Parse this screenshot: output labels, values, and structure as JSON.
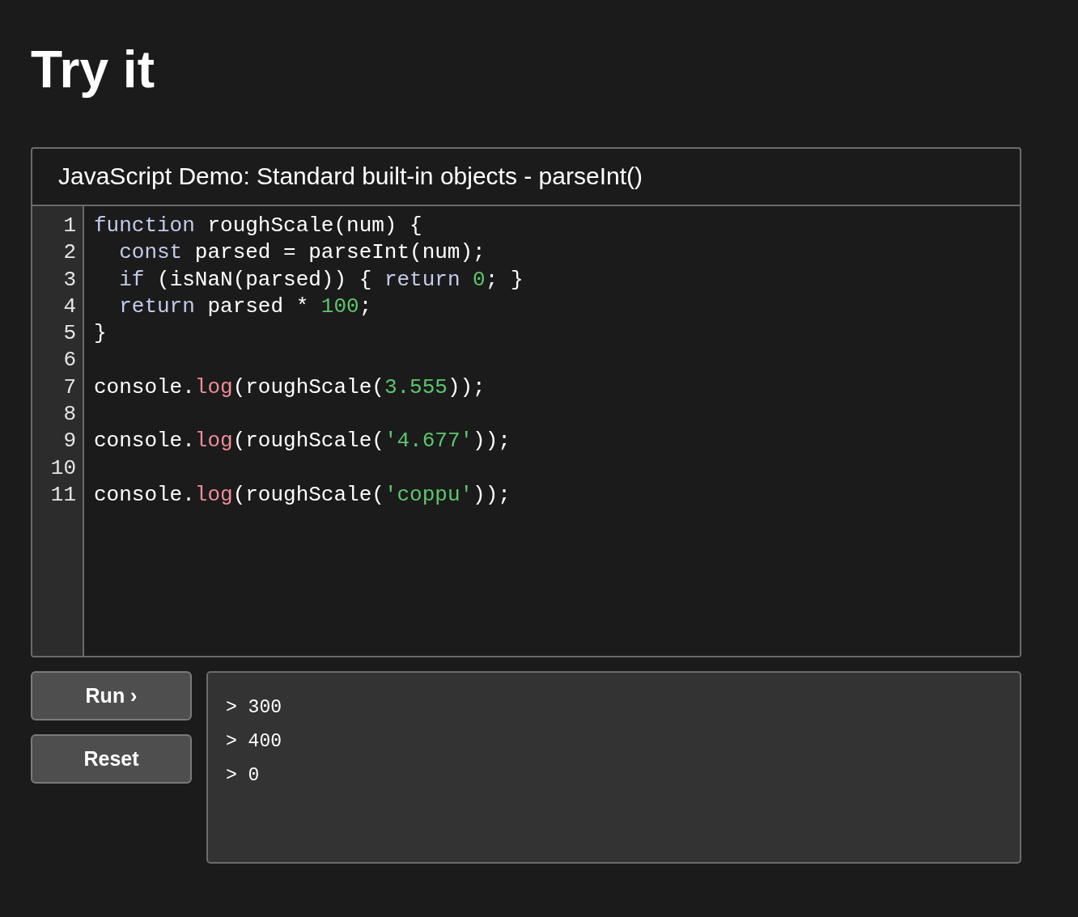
{
  "heading": "Try it",
  "demo": {
    "title": "JavaScript Demo: Standard built-in objects - parseInt()",
    "lines": [
      {
        "number": "1",
        "tokens": [
          {
            "kind": "keyword",
            "text": "function"
          },
          {
            "kind": "plain",
            "text": " roughScale(num) {"
          }
        ]
      },
      {
        "number": "2",
        "tokens": [
          {
            "kind": "keyword",
            "text": "  const"
          },
          {
            "kind": "plain",
            "text": " parsed = parseInt(num);"
          }
        ]
      },
      {
        "number": "3",
        "tokens": [
          {
            "kind": "keyword",
            "text": "  if"
          },
          {
            "kind": "plain",
            "text": " (isNaN(parsed)) { "
          },
          {
            "kind": "keyword",
            "text": "return "
          },
          {
            "kind": "number",
            "text": "0"
          },
          {
            "kind": "plain",
            "text": "; }"
          }
        ]
      },
      {
        "number": "4",
        "tokens": [
          {
            "kind": "keyword",
            "text": "  return"
          },
          {
            "kind": "plain",
            "text": " parsed * "
          },
          {
            "kind": "number",
            "text": "100"
          },
          {
            "kind": "plain",
            "text": ";"
          }
        ]
      },
      {
        "number": "5",
        "tokens": [
          {
            "kind": "plain",
            "text": "}"
          }
        ]
      },
      {
        "number": "6"
      },
      {
        "number": "7",
        "tokens": [
          {
            "kind": "plain",
            "text": "console."
          },
          {
            "kind": "method",
            "text": "log"
          },
          {
            "kind": "plain",
            "text": "(roughScale("
          },
          {
            "kind": "number",
            "text": "3.555"
          },
          {
            "kind": "plain",
            "text": "));"
          }
        ]
      },
      {
        "number": "8"
      },
      {
        "number": "9",
        "tokens": [
          {
            "kind": "plain",
            "text": "console."
          },
          {
            "kind": "method",
            "text": "log"
          },
          {
            "kind": "plain",
            "text": "(roughScale("
          },
          {
            "kind": "string",
            "text": "'4.677'"
          },
          {
            "kind": "plain",
            "text": "));"
          }
        ]
      },
      {
        "number": "10"
      },
      {
        "number": "11",
        "tokens": [
          {
            "kind": "plain",
            "text": "console."
          },
          {
            "kind": "method",
            "text": "log"
          },
          {
            "kind": "plain",
            "text": "(roughScale("
          },
          {
            "kind": "string",
            "text": "'coppu'"
          },
          {
            "kind": "plain",
            "text": "));"
          }
        ]
      }
    ]
  },
  "buttons": [
    {
      "label": "Run ›"
    },
    {
      "label": "Reset"
    }
  ],
  "output": [
    "> 300",
    "> 400",
    "> 0"
  ]
}
